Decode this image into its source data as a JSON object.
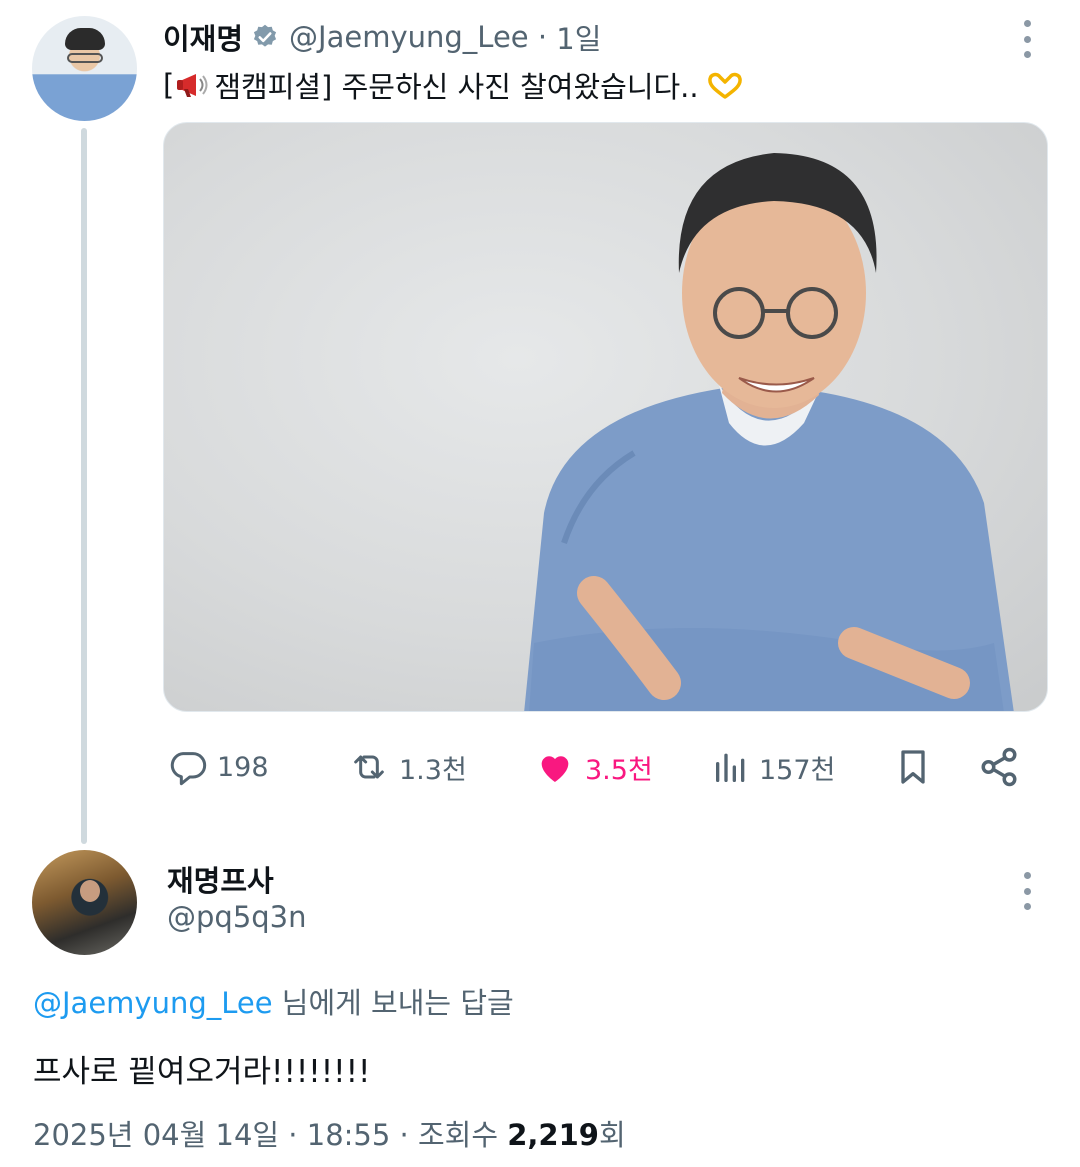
{
  "tweet": {
    "author_name": "이재명",
    "author_handle": "@Jaemyung_Lee",
    "separator": "·",
    "time_ago": "1일",
    "text_open": "[",
    "text_body": "잼캠피셜] 주문하신 사진 찰여왔습니다..",
    "icons": [
      "megaphone-icon",
      "heart-hands-icon"
    ]
  },
  "actions": {
    "replies": "198",
    "retweets": "1.3천",
    "likes": "3.5천",
    "views": "157천"
  },
  "reply": {
    "author_name": "재명프사",
    "author_handle": "@pq5q3n",
    "replying_mention": "@Jaemyung_Lee",
    "replying_suffix": " 님에게 보내는 답글",
    "text": "프사로 끹여오거라!!!!!!!!",
    "date": "2025년 04월 14일 · 18:55 · 조회수 ",
    "views_count": "2,219",
    "views_suffix": "회"
  },
  "colors": {
    "like_pink": "#f91880",
    "link_blue": "#1d9bf0",
    "muted_gray": "#536471"
  }
}
